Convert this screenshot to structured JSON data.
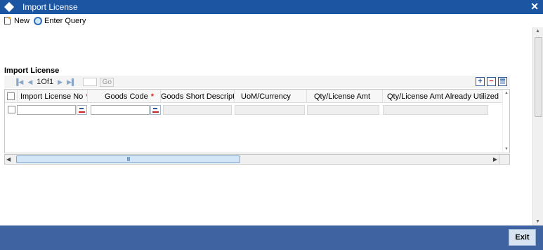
{
  "window": {
    "title": "Import License",
    "icons": {
      "window": "diamond-icon",
      "close": "close-icon"
    }
  },
  "toolbar": {
    "new_label": "New",
    "enter_query_label": "Enter Query"
  },
  "section": {
    "title": "Import License"
  },
  "pager": {
    "page_text": "1Of1",
    "go_label": "Go",
    "page_input_value": ""
  },
  "grid": {
    "columns": [
      {
        "label": "Import License No",
        "required": true
      },
      {
        "label": "Goods Code",
        "required": true
      },
      {
        "label": "Goods Short Description",
        "required": false
      },
      {
        "label": "UoM/Currency",
        "required": false
      },
      {
        "label": "Qty/License Amt",
        "required": false
      },
      {
        "label": "Qty/License Amt Already Utilized",
        "required": false
      }
    ],
    "required_marker": "*",
    "rows": [
      {
        "import_license_no": "",
        "goods_code": "",
        "goods_short_description": "",
        "uom_currency": "",
        "qty_license_amt": "",
        "qty_license_amt_utilized": ""
      }
    ],
    "action_icons": [
      "add-row-icon",
      "delete-row-icon",
      "single-view-icon"
    ]
  },
  "hscroll": {
    "thumb_label": "III"
  },
  "footer": {
    "exit_label": "Exit"
  },
  "colors": {
    "titlebar": "#1c56a3",
    "footer": "#3f63a0",
    "required": "#e21f1f"
  }
}
